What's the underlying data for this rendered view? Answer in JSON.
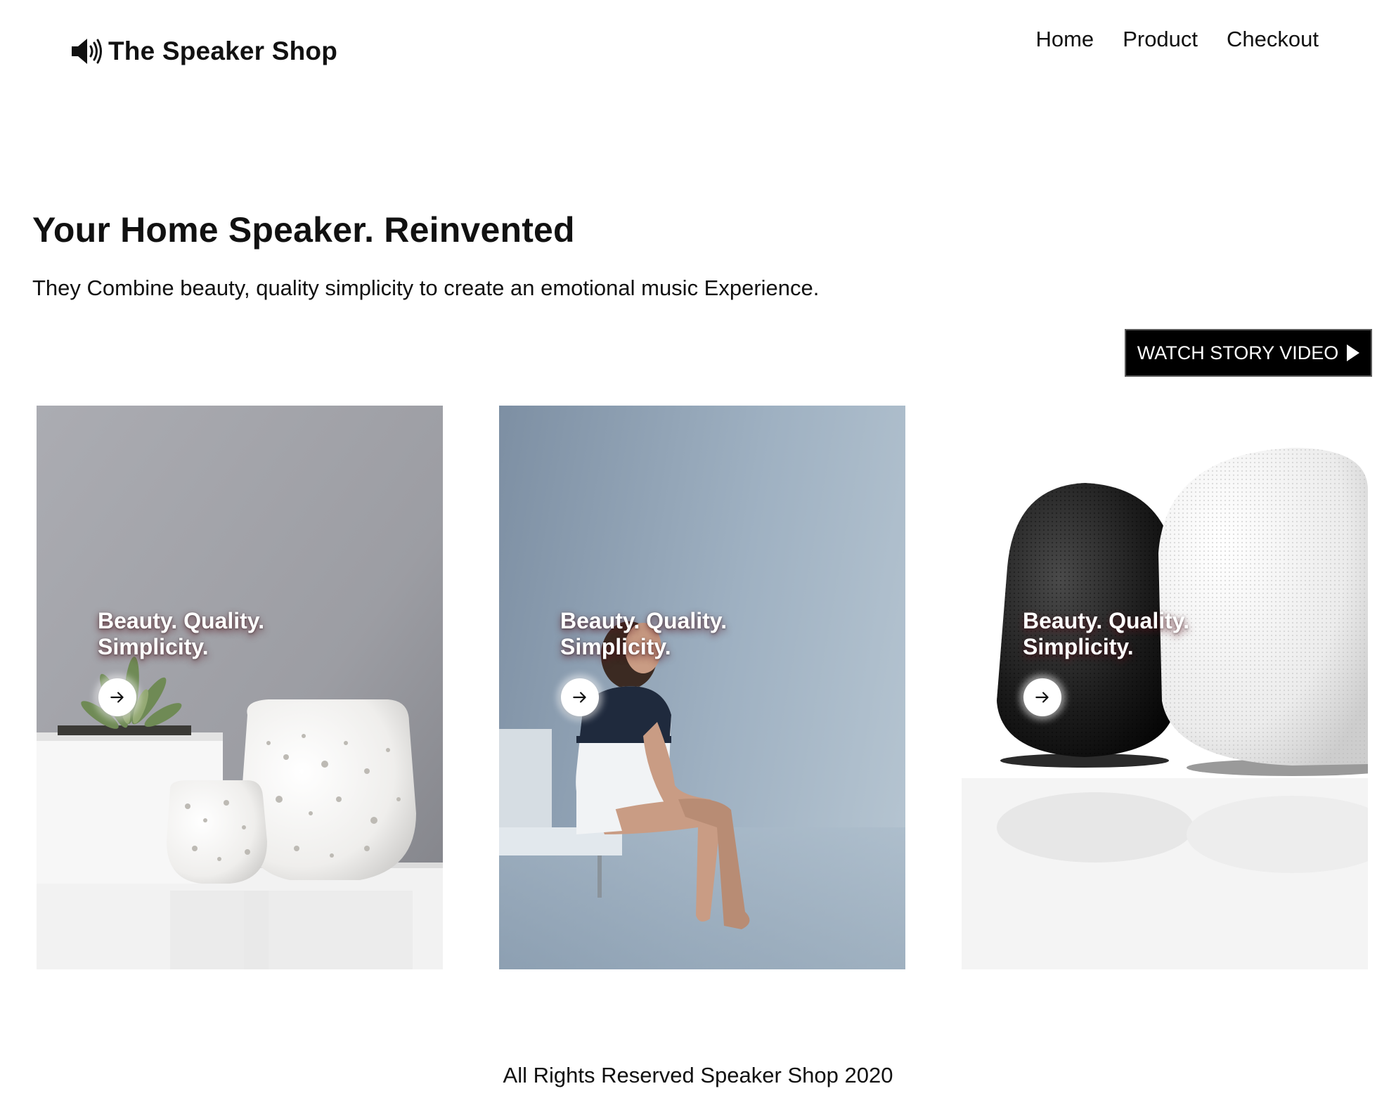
{
  "header": {
    "brand": "The Speaker Shop",
    "brand_icon": "speaker-volume-icon",
    "nav": [
      {
        "label": "Home"
      },
      {
        "label": "Product"
      },
      {
        "label": "Checkout"
      }
    ]
  },
  "hero": {
    "title": "Your Home Speaker. Reinvented",
    "subtitle": "They Combine beauty, quality simplicity to create an emotional music Experience.",
    "video_button": "WATCH STORY VIDEO",
    "video_button_icon": "play-icon"
  },
  "cards": [
    {
      "image": "succulent-and-white-vases",
      "caption_line1": "Beauty. Quality.",
      "caption_line2": "Simplicity.",
      "button_icon": "arrow-right-icon"
    },
    {
      "image": "woman-sitting-on-bench",
      "caption_line1": "Beauty. Quality.",
      "caption_line2": "Simplicity.",
      "button_icon": "arrow-right-icon"
    },
    {
      "image": "black-and-white-speakers",
      "caption_line1": "Beauty. Quality.",
      "caption_line2": "Simplicity.",
      "button_icon": "arrow-right-icon"
    }
  ],
  "footer": {
    "text": "All Rights Reserved Speaker Shop 2020"
  },
  "colors": {
    "text": "#111111",
    "background": "#ffffff",
    "button": "#000000",
    "button_text": "#ffffff"
  }
}
